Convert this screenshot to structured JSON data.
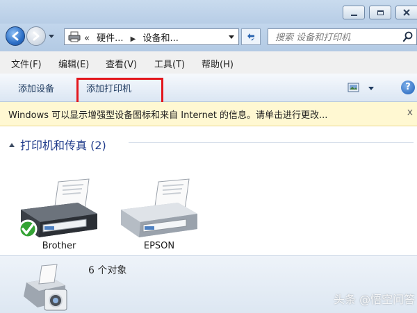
{
  "nav": {
    "breadcrumbs": [
      "«",
      "硬件...",
      "设备和..."
    ],
    "search_placeholder": "搜索 设备和打印机"
  },
  "menu": [
    "文件(F)",
    "编辑(E)",
    "查看(V)",
    "工具(T)",
    "帮助(H)"
  ],
  "commands": {
    "add_device": "添加设备",
    "add_printer": "添加打印机",
    "help_glyph": "?"
  },
  "infobar": {
    "message": "Windows 可以显示增强型设备图标和来自 Internet 的信息。请单击进行更改...",
    "close": "x"
  },
  "group": {
    "title": "打印机和传真 (2)",
    "devices": [
      {
        "name": "Brother",
        "default": true
      },
      {
        "name": "EPSON",
        "default": false
      }
    ]
  },
  "details": {
    "count": "6 个对象"
  },
  "watermark": "头条 @悟空问答",
  "colors": {
    "highlight": "#e3161c",
    "link": "#1e3a8a",
    "infobar_bg": "#fff8d2"
  }
}
